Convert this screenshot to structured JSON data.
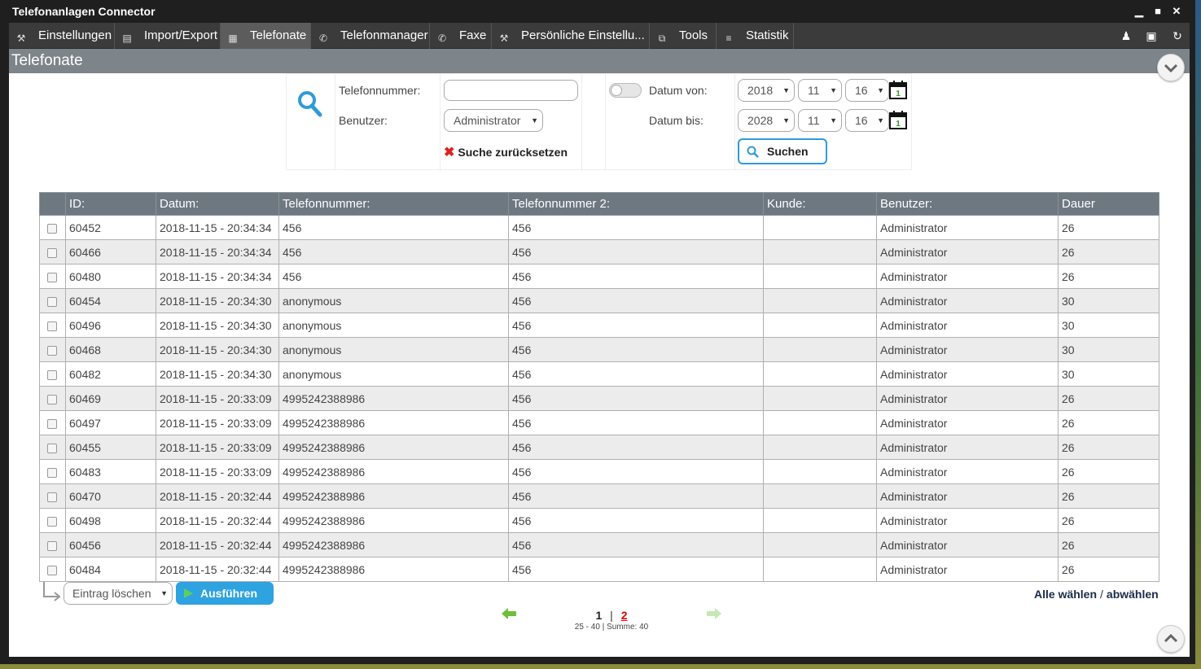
{
  "window": {
    "title": "Telefonanlagen Connector"
  },
  "menu": [
    {
      "label": "Einstellungen",
      "icon": "wrench-icon"
    },
    {
      "label": "Import/Export",
      "icon": "file-icon"
    },
    {
      "label": "Telefonate",
      "icon": "grid-icon",
      "active": true
    },
    {
      "label": "Telefonmanager",
      "icon": "phone-icon"
    },
    {
      "label": "Faxe",
      "icon": "phone-icon"
    },
    {
      "label": "Persönliche Einstellu...",
      "icon": "wrench-icon"
    },
    {
      "label": "Tools",
      "icon": "tools-icon"
    },
    {
      "label": "Statistik",
      "icon": "stats-icon"
    }
  ],
  "section": {
    "title": "Telefonate"
  },
  "search": {
    "phone_label": "Telefonnummer:",
    "phone_value": "",
    "user_label": "Benutzer:",
    "user_value": "Administrator",
    "date_from_label": "Datum von:",
    "date_to_label": "Datum bis:",
    "date_from": {
      "year": "2018",
      "month": "11",
      "day": "16"
    },
    "date_to": {
      "year": "2028",
      "month": "11",
      "day": "16"
    },
    "reset_label": "Suche zurücksetzen",
    "search_label": "Suchen"
  },
  "table": {
    "headers": [
      "ID:",
      "Datum:",
      "Telefonnummer:",
      "Telefonnummer 2:",
      "Kunde:",
      "Benutzer:",
      "Dauer"
    ],
    "rows": [
      [
        "60452",
        "2018-11-15 - 20:34:34",
        "456",
        "456",
        "",
        "Administrator",
        "26"
      ],
      [
        "60466",
        "2018-11-15 - 20:34:34",
        "456",
        "456",
        "",
        "Administrator",
        "26"
      ],
      [
        "60480",
        "2018-11-15 - 20:34:34",
        "456",
        "456",
        "",
        "Administrator",
        "26"
      ],
      [
        "60454",
        "2018-11-15 - 20:34:30",
        "anonymous",
        "456",
        "",
        "Administrator",
        "30"
      ],
      [
        "60496",
        "2018-11-15 - 20:34:30",
        "anonymous",
        "456",
        "",
        "Administrator",
        "30"
      ],
      [
        "60468",
        "2018-11-15 - 20:34:30",
        "anonymous",
        "456",
        "",
        "Administrator",
        "30"
      ],
      [
        "60482",
        "2018-11-15 - 20:34:30",
        "anonymous",
        "456",
        "",
        "Administrator",
        "30"
      ],
      [
        "60469",
        "2018-11-15 - 20:33:09",
        "4995242388986",
        "456",
        "",
        "Administrator",
        "26"
      ],
      [
        "60497",
        "2018-11-15 - 20:33:09",
        "4995242388986",
        "456",
        "",
        "Administrator",
        "26"
      ],
      [
        "60455",
        "2018-11-15 - 20:33:09",
        "4995242388986",
        "456",
        "",
        "Administrator",
        "26"
      ],
      [
        "60483",
        "2018-11-15 - 20:33:09",
        "4995242388986",
        "456",
        "",
        "Administrator",
        "26"
      ],
      [
        "60470",
        "2018-11-15 - 20:32:44",
        "4995242388986",
        "456",
        "",
        "Administrator",
        "26"
      ],
      [
        "60498",
        "2018-11-15 - 20:32:44",
        "4995242388986",
        "456",
        "",
        "Administrator",
        "26"
      ],
      [
        "60456",
        "2018-11-15 - 20:32:44",
        "4995242388986",
        "456",
        "",
        "Administrator",
        "26"
      ],
      [
        "60484",
        "2018-11-15 - 20:32:44",
        "4995242388986",
        "456",
        "",
        "Administrator",
        "26"
      ]
    ]
  },
  "bulk": {
    "action": "Eintrag löschen",
    "run_label": "Ausführen"
  },
  "selection": {
    "select_all": "Alle wählen",
    "separator": "/",
    "deselect": "abwählen"
  },
  "pagination": {
    "page1": "1",
    "separator": "|",
    "page2": "2",
    "info": "25 - 40 | Summe: 40"
  }
}
